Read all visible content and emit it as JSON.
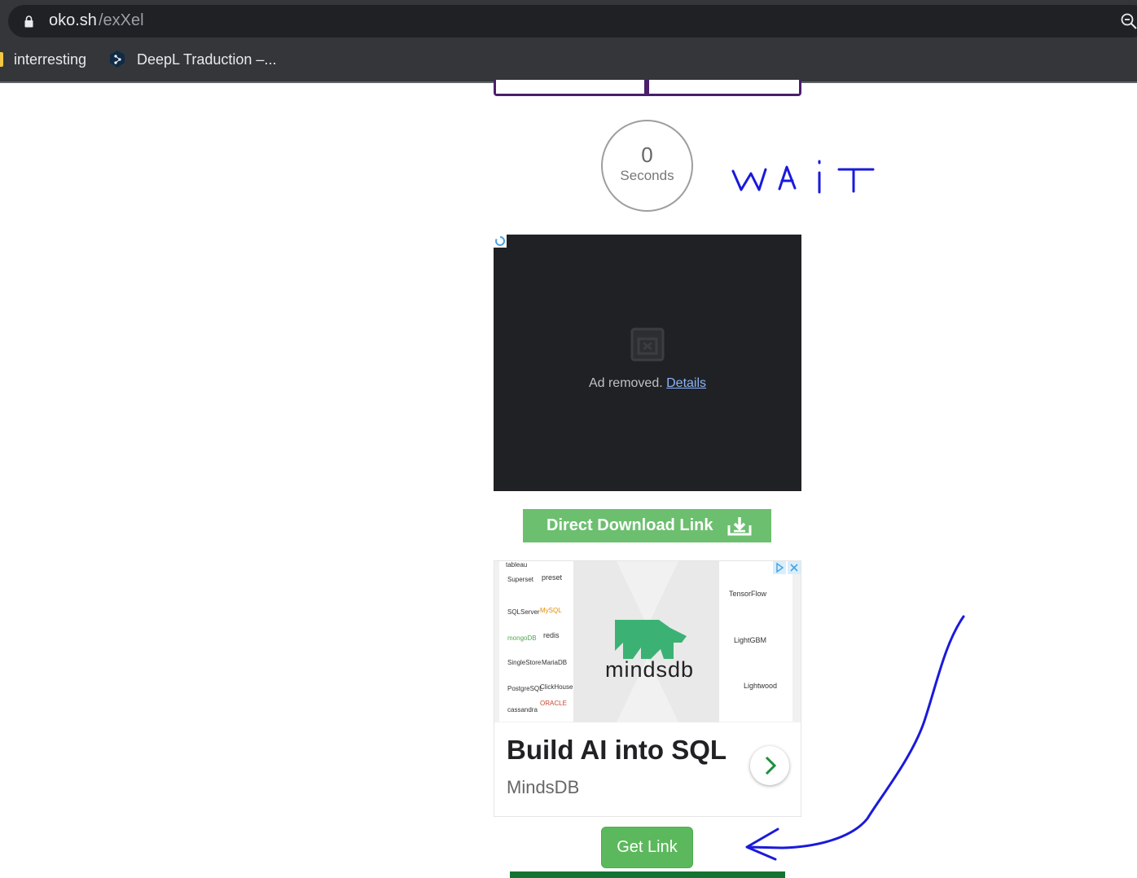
{
  "browser": {
    "url_host": "oko.sh",
    "url_path": "/exXel",
    "bookmarks": [
      {
        "label": "interresting"
      },
      {
        "label": "DeepL Traduction –..."
      }
    ]
  },
  "timer": {
    "value": "0",
    "label": "Seconds"
  },
  "annotation": {
    "wait_text": "WAIT"
  },
  "ad_removed": {
    "text": "Ad removed.",
    "link": "Details"
  },
  "download": {
    "label": "Direct Download Link"
  },
  "ad": {
    "brand": "mindsdb",
    "headline": "Build AI into SQL",
    "advertiser": "MindsDB",
    "left_logos": [
      "tableau",
      "Superset",
      "preset",
      "SQLServer",
      "MySQL",
      "mongoDB",
      "redis",
      "SingleStore",
      "MariaDB",
      "PostgreSQL",
      "ClickHouse",
      "cassandra",
      "ORACLE"
    ],
    "right_logos": [
      "TensorFlow",
      "LightGBM",
      "Lightwood"
    ]
  },
  "get_link": {
    "label": "Get Link"
  },
  "colors": {
    "chrome_bg": "#35363a",
    "tabs_border": "#4a1f6e",
    "download_green": "#6cbf6f",
    "getlink_green": "#5cb85c",
    "ink_blue": "#1a1adb",
    "mindsdb_green": "#3bb273"
  }
}
